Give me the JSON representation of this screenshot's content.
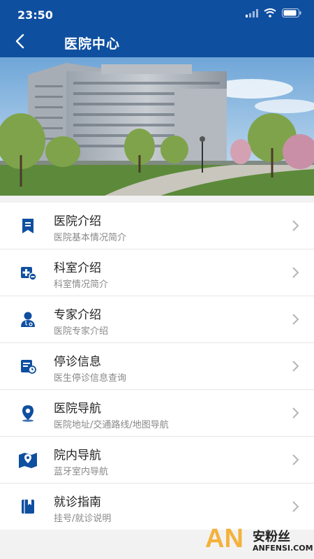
{
  "status_bar": {
    "time": "23:50"
  },
  "header": {
    "title": "医院中心"
  },
  "menu": {
    "items": [
      {
        "title": "医院介绍",
        "subtitle": "医院基本情况简介",
        "icon": "bookmark-icon"
      },
      {
        "title": "科室介绍",
        "subtitle": "科室情况简介",
        "icon": "department-icon"
      },
      {
        "title": "专家介绍",
        "subtitle": "医院专家介绍",
        "icon": "doctor-icon"
      },
      {
        "title": "停诊信息",
        "subtitle": "医生停诊信息查询",
        "icon": "notice-icon"
      },
      {
        "title": "医院导航",
        "subtitle": "医院地址/交通路线/地图导航",
        "icon": "location-pin-icon"
      },
      {
        "title": "院内导航",
        "subtitle": "蓝牙室内导航",
        "icon": "map-icon"
      },
      {
        "title": "就诊指南",
        "subtitle": "挂号/就诊说明",
        "icon": "guide-book-icon"
      }
    ]
  },
  "watermark": {
    "logo": "AN",
    "cn": "安粉丝",
    "en": "ANFENSI.COM"
  },
  "colors": {
    "primary": "#0f4fa0",
    "watermark_accent": "#f4b23b"
  }
}
